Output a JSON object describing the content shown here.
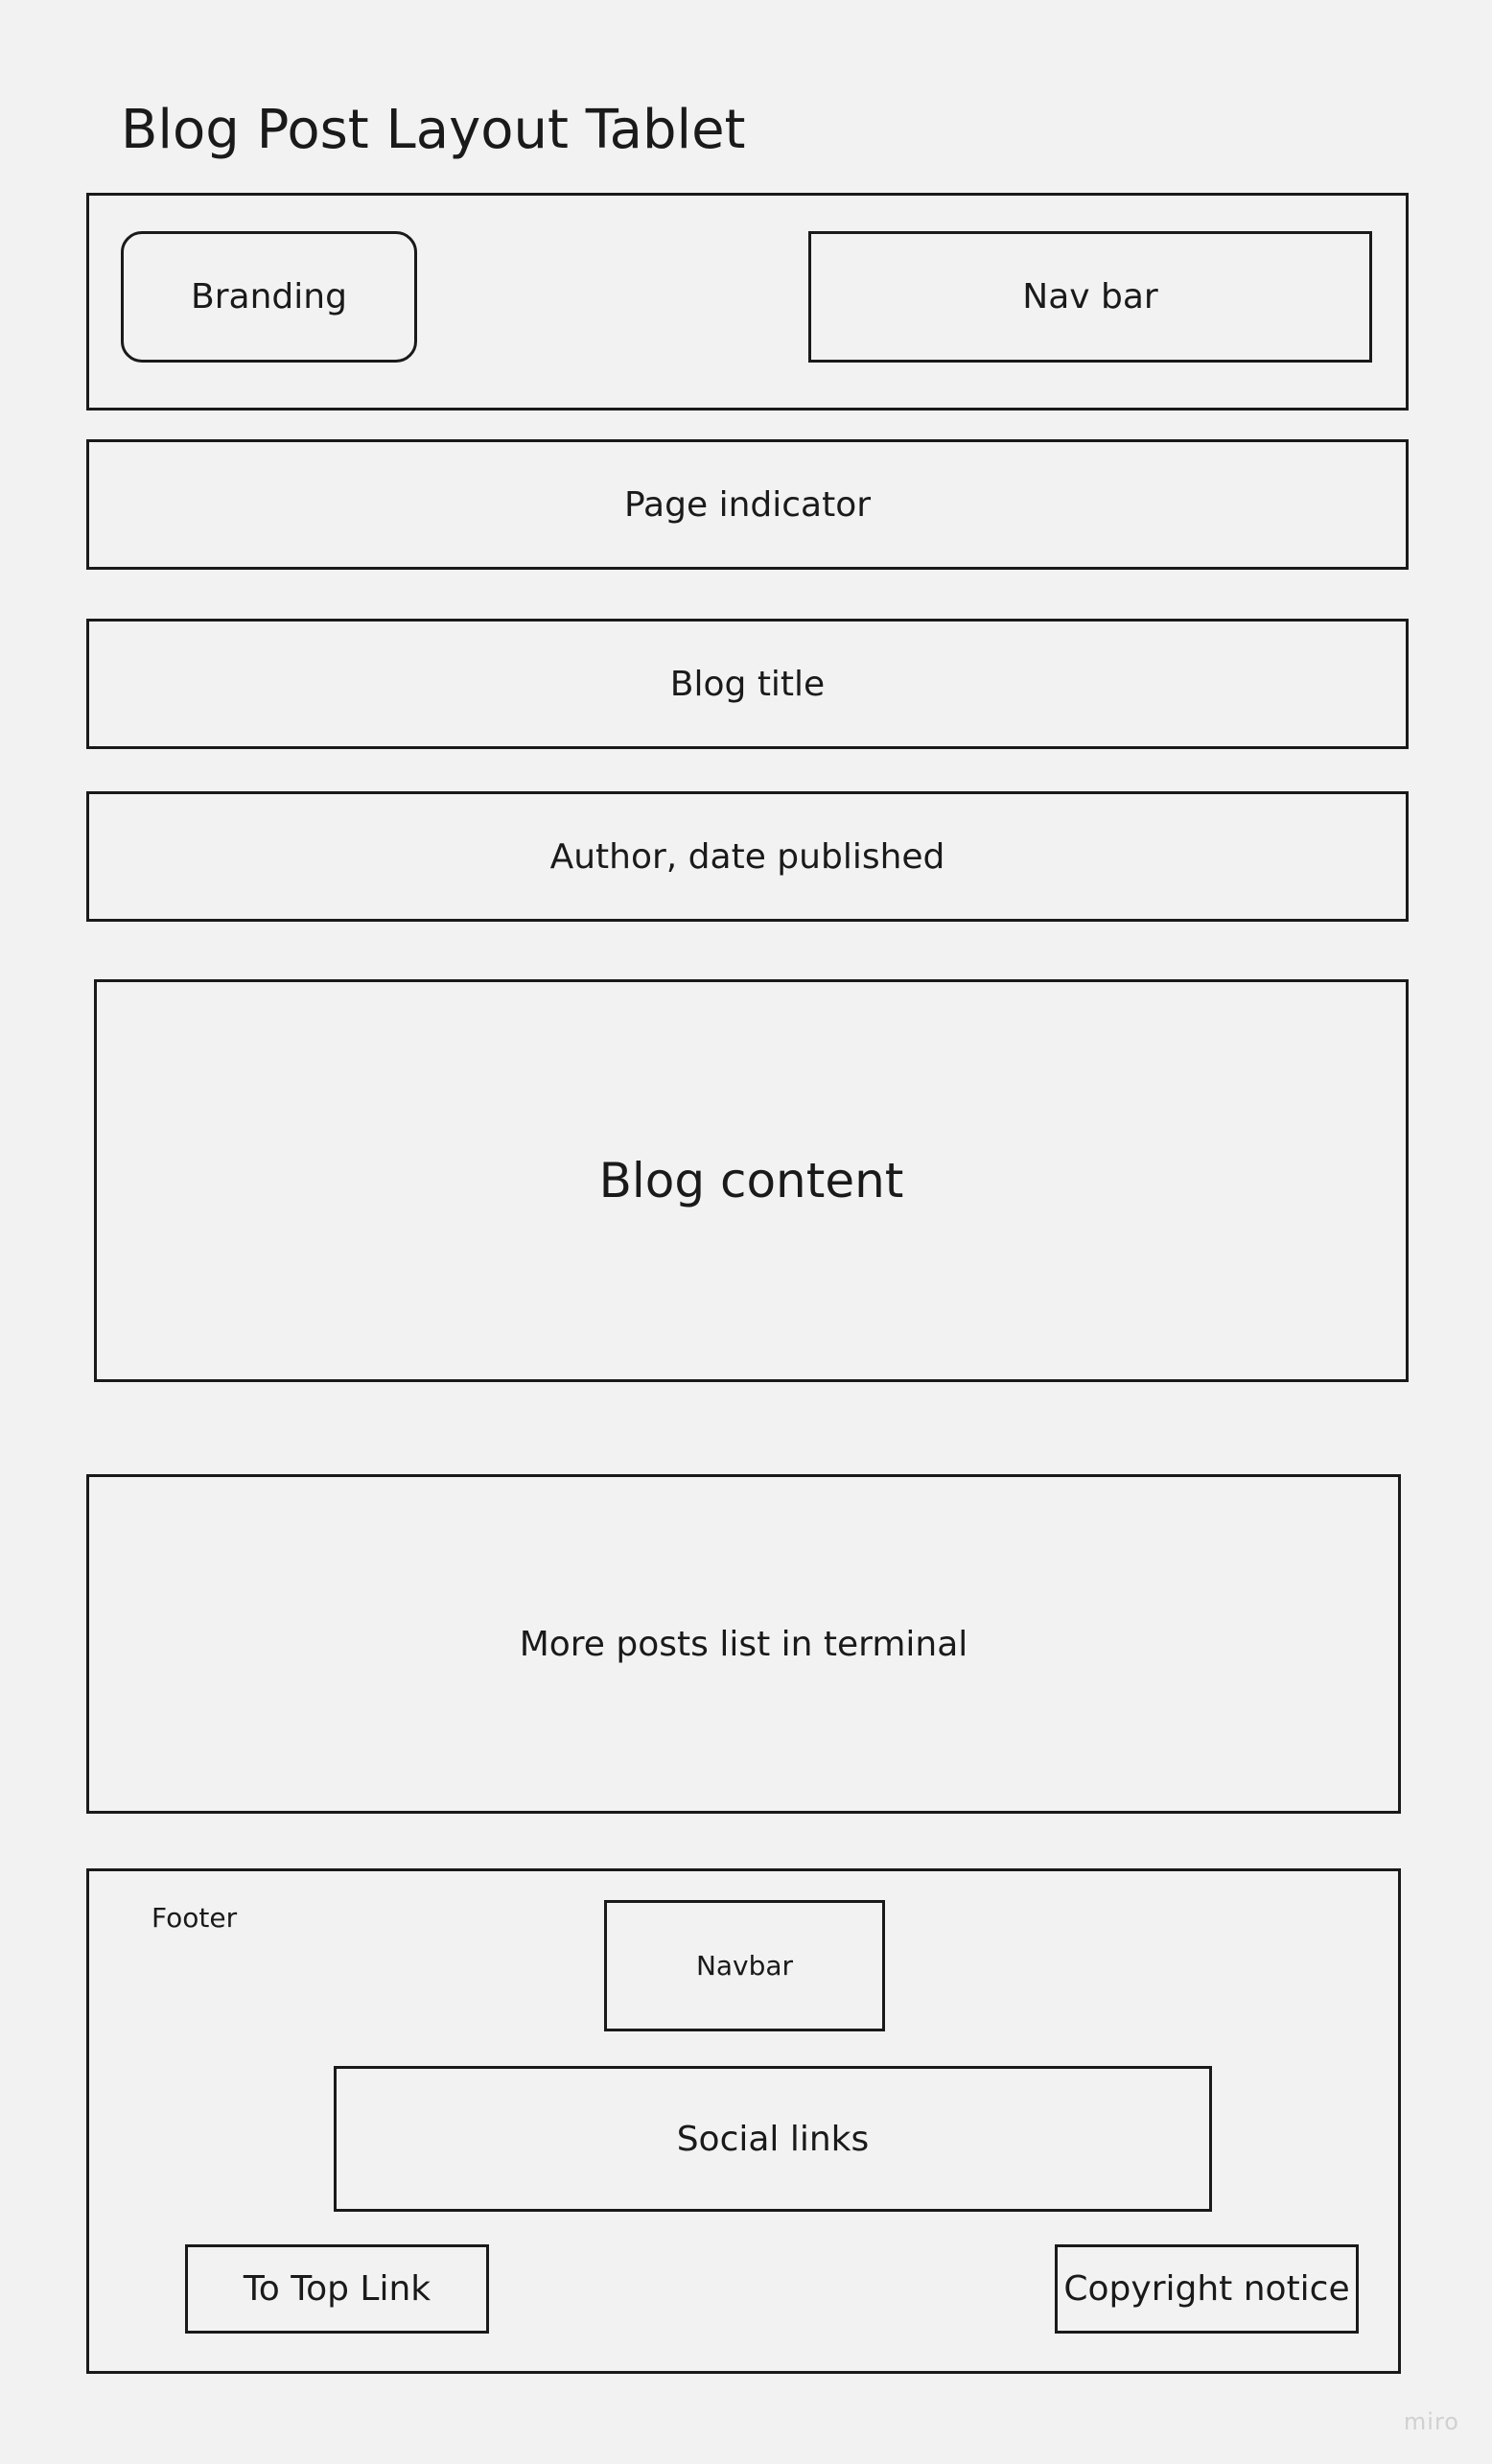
{
  "page_title": "Blog Post Layout Tablet",
  "header": {
    "branding": "Branding",
    "nav_bar": "Nav bar"
  },
  "page_indicator": "Page indicator",
  "blog_title": "Blog title",
  "author_date": "Author, date published",
  "blog_content": "Blog content",
  "more_posts": "More posts list in terminal",
  "footer": {
    "label": "Footer",
    "navbar": "Navbar",
    "social_links": "Social links",
    "to_top_link": "To Top Link",
    "copyright": "Copyright notice"
  },
  "watermark": "miro"
}
